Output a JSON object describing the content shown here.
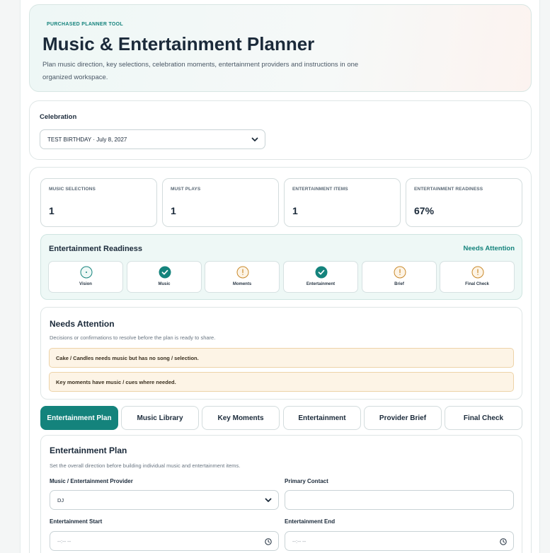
{
  "hero": {
    "tag": "PURCHASED PLANNER TOOL",
    "title": "Music & Entertainment Planner",
    "description": "Plan music direction, key selections, celebration moments, entertainment providers and instructions in one organized workspace."
  },
  "celebration": {
    "label": "Celebration",
    "selected": "TEST BIRTHDAY · July 8, 2027"
  },
  "stats": [
    {
      "label": "MUSIC SELECTIONS",
      "value": "1"
    },
    {
      "label": "MUST PLAYS",
      "value": "1"
    },
    {
      "label": "ENTERTAINMENT ITEMS",
      "value": "1"
    },
    {
      "label": "ENTERTAINMENT READINESS",
      "value": "67%"
    }
  ],
  "readiness": {
    "title": "Entertainment Readiness",
    "status": "Needs Attention",
    "steps": [
      {
        "label": "Vision",
        "state": "pending",
        "icon": "dot-icon"
      },
      {
        "label": "Music",
        "state": "complete",
        "icon": "check-icon"
      },
      {
        "label": "Moments",
        "state": "warning",
        "icon": "exclamation-icon"
      },
      {
        "label": "Entertainment",
        "state": "complete",
        "icon": "check-icon"
      },
      {
        "label": "Brief",
        "state": "warning",
        "icon": "exclamation-icon"
      },
      {
        "label": "Final Check",
        "state": "warning",
        "icon": "exclamation-icon"
      }
    ]
  },
  "needs_attention": {
    "title": "Needs Attention",
    "description": "Decisions or confirmations to resolve before the plan is ready to share.",
    "items": [
      "Cake / Candles needs music but has no song / selection.",
      "Key moments have music / cues where needed."
    ]
  },
  "tabs": [
    {
      "label": "Entertainment Plan",
      "active": true
    },
    {
      "label": "Music Library",
      "active": false
    },
    {
      "label": "Key Moments",
      "active": false
    },
    {
      "label": "Entertainment",
      "active": false
    },
    {
      "label": "Provider Brief",
      "active": false
    },
    {
      "label": "Final Check",
      "active": false
    }
  ],
  "plan": {
    "title": "Entertainment Plan",
    "description": "Set the overall direction before building individual music and entertainment items.",
    "provider_label": "Music / Entertainment Provider",
    "provider_value": "DJ",
    "contact_label": "Primary Contact",
    "contact_value": "",
    "start_label": "Entertainment Start",
    "start_value": "--:-- --",
    "end_label": "Entertainment End",
    "end_value": "--:-- --"
  },
  "colors": {
    "accent": "#14837c",
    "warning": "#c9892a",
    "alert_bg": "#fdf4e6"
  }
}
